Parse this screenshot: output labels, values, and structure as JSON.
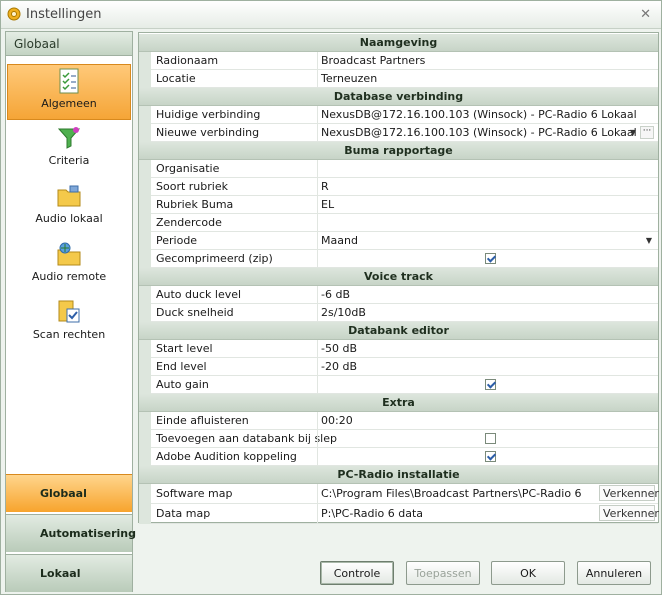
{
  "window": {
    "title": "Instellingen"
  },
  "sidebar": {
    "header": "Globaal",
    "items": [
      {
        "label": "Algemeen",
        "icon": "checklist-icon",
        "active": true
      },
      {
        "label": "Criteria",
        "icon": "filter-funnel-icon",
        "active": false
      },
      {
        "label": "Audio lokaal",
        "icon": "folder-local-icon",
        "active": false
      },
      {
        "label": "Audio remote",
        "icon": "folder-network-icon",
        "active": false
      },
      {
        "label": "Scan rechten",
        "icon": "scan-check-icon",
        "active": false
      }
    ],
    "tabs": [
      {
        "label": "Globaal",
        "active": true
      },
      {
        "label": "Automatisering",
        "active": false
      },
      {
        "label": "Lokaal",
        "active": false
      }
    ]
  },
  "grid": {
    "sections": [
      {
        "title": "Naamgeving",
        "rows": [
          {
            "name": "Radionaam",
            "value": "Broadcast Partners"
          },
          {
            "name": "Locatie",
            "value": "Terneuzen"
          }
        ]
      },
      {
        "title": "Database verbinding",
        "rows": [
          {
            "name": "Huidige verbinding",
            "value": "NexusDB@172.16.100.103 (Winsock) - PC-Radio 6 Lokaal"
          },
          {
            "name": "Nieuwe verbinding",
            "value": "NexusDB@172.16.100.103 (Winsock) - PC-Radio 6 Lokaal"
          }
        ]
      },
      {
        "title": "Buma rapportage",
        "rows": [
          {
            "name": "Organisatie",
            "value": ""
          },
          {
            "name": "Soort rubriek",
            "value": "R"
          },
          {
            "name": "Rubriek Buma",
            "value": "EL"
          },
          {
            "name": "Zendercode",
            "value": ""
          },
          {
            "name": "Periode",
            "value": "Maand"
          },
          {
            "name": "Gecomprimeerd (zip)",
            "checked": true
          }
        ]
      },
      {
        "title": "Voice track",
        "rows": [
          {
            "name": "Auto duck level",
            "value": "-6 dB"
          },
          {
            "name": "Duck snelheid",
            "value": "2s/10dB"
          }
        ]
      },
      {
        "title": "Databank editor",
        "rows": [
          {
            "name": "Start level",
            "value": "-50 dB"
          },
          {
            "name": "End level",
            "value": "-20 dB"
          },
          {
            "name": "Auto gain",
            "checked": true
          }
        ]
      },
      {
        "title": "Extra",
        "rows": [
          {
            "name": "Einde afluisteren",
            "value": "00:20"
          },
          {
            "name": "Toevoegen aan databank bij slep",
            "checked": false
          },
          {
            "name": "Adobe Audition koppeling",
            "checked": true
          }
        ]
      },
      {
        "title": "PC-Radio installatie",
        "rows": [
          {
            "name": "Software map",
            "value": "C:\\Program Files\\Broadcast Partners\\PC-Radio 6",
            "browse": "Verkenner"
          },
          {
            "name": "Data map",
            "value": "P:\\PC-Radio 6 data",
            "browse": "Verkenner"
          }
        ]
      }
    ]
  },
  "buttons": {
    "controle": "Controle",
    "toepassen": "Toepassen",
    "ok": "OK",
    "annuleren": "Annuleren"
  },
  "colors": {
    "accent_orange": "#f5a537",
    "section_green": "#c7d4c7",
    "check_blue": "#2d5ea8"
  }
}
